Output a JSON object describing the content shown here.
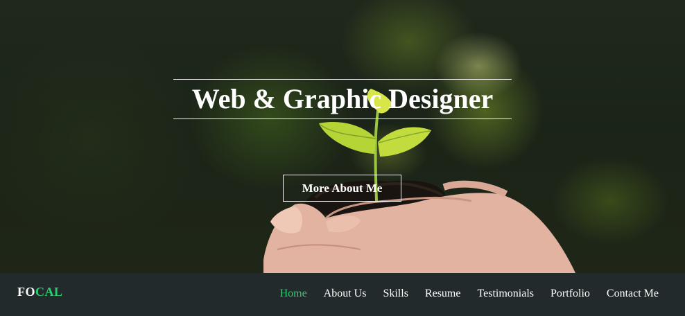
{
  "hero": {
    "title": "Web & Graphic Designer",
    "cta_label": "More About Me"
  },
  "brand": {
    "logo_part1": "FO",
    "logo_part2": "CAL"
  },
  "nav": {
    "items": [
      {
        "label": "Home",
        "active": true
      },
      {
        "label": "About Us"
      },
      {
        "label": "Skills"
      },
      {
        "label": "Resume"
      },
      {
        "label": "Testimonials"
      },
      {
        "label": "Portfolio"
      },
      {
        "label": "Contact Me"
      }
    ]
  },
  "colors": {
    "accent": "#2ecc71",
    "navbar_bg": "#232a2c",
    "text": "#ffffff"
  }
}
